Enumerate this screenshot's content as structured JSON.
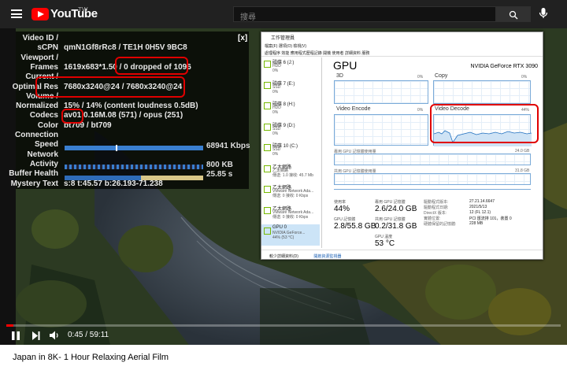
{
  "header": {
    "brand": "YouTube",
    "region": "TW",
    "search_placeholder": "搜尋"
  },
  "stats": {
    "rows": [
      {
        "label": "Video ID /",
        "value": ""
      },
      {
        "label": "sCPN",
        "value": "qmN1Gf8rRc8 / TE1H 0H5V 9BC8"
      },
      {
        "label": "Viewport /",
        "value": ""
      },
      {
        "label": "Frames",
        "value": "1619x683*1.50 / 0 dropped of 1096"
      },
      {
        "label": "Current /",
        "value": ""
      },
      {
        "label": "Optimal Res",
        "value": "7680x3240@24 / 7680x3240@24"
      },
      {
        "label": "Volume /",
        "value": ""
      },
      {
        "label": "Normalized",
        "value": "15% / 14% (content loudness 0.5dB)"
      },
      {
        "label": "Codecs",
        "value": "av01.0.16M.08 (571) / opus (251)"
      },
      {
        "label": "Color",
        "value": "bt709 / bt709"
      },
      {
        "label": "Connection",
        "value": ""
      },
      {
        "label": "Speed",
        "value": ""
      },
      {
        "label": "Network",
        "value": ""
      },
      {
        "label": "Activity",
        "value": ""
      },
      {
        "label": "Buffer Health",
        "value": ""
      },
      {
        "label": "Mystery Text",
        "value": "s:8 t:45.57 b:26.193-71.238"
      }
    ],
    "speed_value": "68941 Kbps",
    "activity_value": "800 KB",
    "buffer_value": "25.85 s",
    "close": "[x]"
  },
  "task_manager": {
    "title": "工作管理員",
    "menu": "檔案(F)   選項(O)   檢視(V)",
    "tabs": "處理程序   效能   應用程式歷程記錄   開機   使用者   詳細資料   服務",
    "devices": [
      {
        "title": "磁碟 6 (J:)",
        "sub": "HDD",
        "val": "0%"
      },
      {
        "title": "磁碟 7 (E:)",
        "sub": "SSD",
        "val": "0%"
      },
      {
        "title": "磁碟 8 (H:)",
        "sub": "HDD",
        "val": "0%"
      },
      {
        "title": "磁碟 9 (D:)",
        "sub": "SSD",
        "val": "0%"
      },
      {
        "title": "磁碟 10 (C:)",
        "sub": "SSD",
        "val": "0%"
      },
      {
        "title": "乙太網路",
        "sub": "乙太網路",
        "val": "傳送: 1.0 接收: 45.7 Mb"
      },
      {
        "title": "乙太網路",
        "sub": "VMware Network Ada...",
        "val": "傳送: 0 接收: 0 Kbps"
      },
      {
        "title": "乙太網路",
        "sub": "VMware Network Ada...",
        "val": "傳送: 0 接收: 0 Kbps"
      },
      {
        "title": "GPU 0",
        "sub": "NVIDIA GeForce...",
        "val": "44% (53 °C)"
      }
    ],
    "gpu_title": "GPU",
    "gpu_name": "NVIDIA GeForce RTX 3090",
    "engines": [
      {
        "label": "3D",
        "pct": "0%"
      },
      {
        "label": "Copy",
        "pct": "0%"
      },
      {
        "label": "Video Encode",
        "pct": "0%"
      },
      {
        "label": "Video Decode",
        "pct": "44%"
      }
    ],
    "dedicated_label": "專用 GPU 記憶體使用量",
    "dedicated_max": "24.0 GB",
    "shared_label": "共用 GPU 記憶體使用量",
    "shared_max": "31.8 GB",
    "stats": [
      {
        "label": "使用率",
        "value": "44%"
      },
      {
        "label": "專用 GPU 記憶體",
        "value": "2.6/24.0 GB"
      },
      {
        "label": "GPU 記憶體",
        "value": "2.8/55.8 GB"
      },
      {
        "label": "共用 GPU 記憶體",
        "value": "0.2/31.8 GB"
      },
      {
        "label": "GPU 溫度",
        "value": "53 °C"
      }
    ],
    "info": [
      {
        "k": "驅動程式版本:",
        "v": "27.21.14.6647"
      },
      {
        "k": "驅動程式日期:",
        "v": "2021/5/13"
      },
      {
        "k": "DirectX 版本:",
        "v": "12 (FL 12.1)"
      },
      {
        "k": "實體位置:",
        "v": "PCI 匯流排 101，裝置 0"
      },
      {
        "k": "硬體保留的記憶體:",
        "v": "228 MB"
      }
    ],
    "footer_less": "較少詳細資料(D)",
    "footer_monitor": "開啟資源監視器"
  },
  "player": {
    "time": "0:45 / 59:11",
    "progress": 0.013
  },
  "video": {
    "title": "Japan in 8K- 1 Hour Relaxing Aerial Film"
  },
  "colors": {
    "accent": "#ff0000",
    "annotation": "#e00000",
    "speed_bar": "#3a7fd0",
    "gpu_line": "#1f6fbf"
  }
}
